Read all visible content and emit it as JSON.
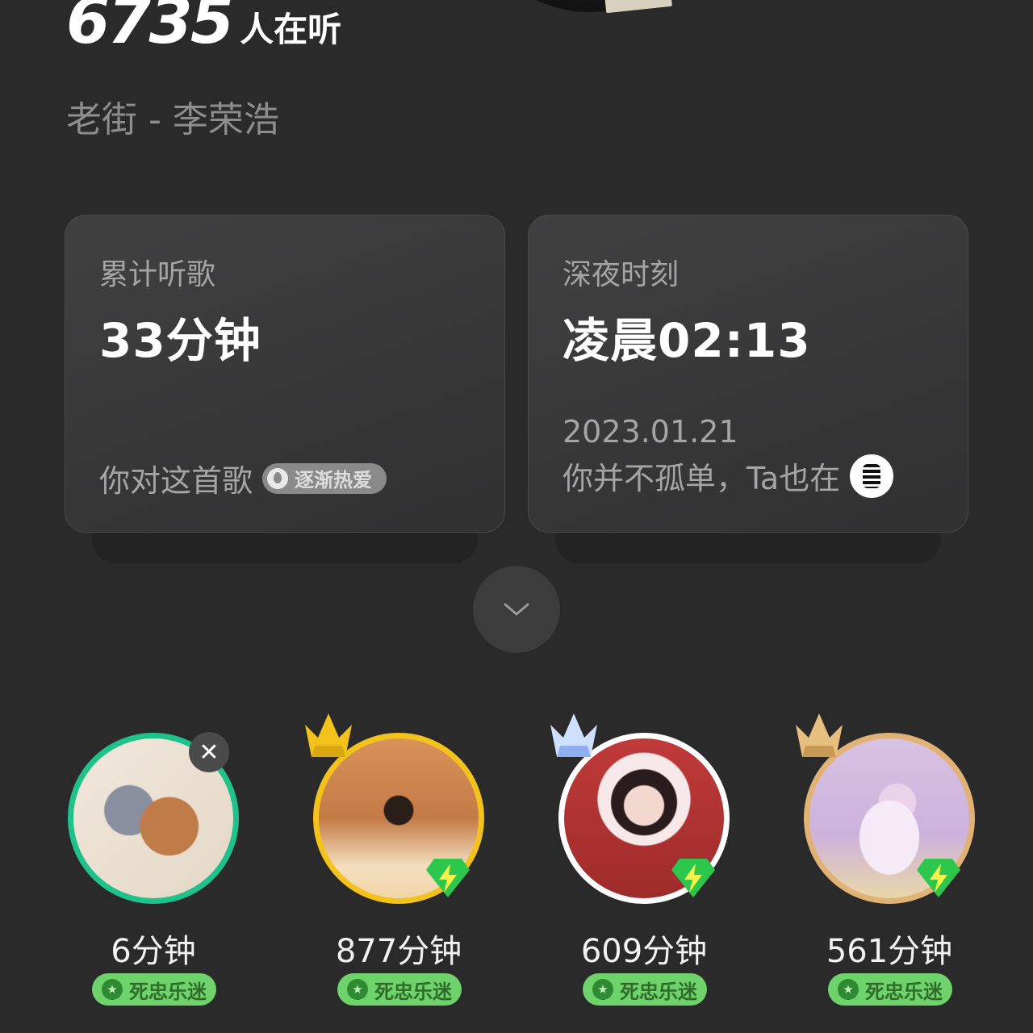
{
  "header": {
    "listener_count": "6735",
    "listener_unit": "人在听",
    "song_title": "老街 - 李荣浩"
  },
  "cards": [
    {
      "label": "累计听歌",
      "value": "33分钟",
      "footer_text": "你对这首歌",
      "tag": "逐渐热爱"
    },
    {
      "label": "深夜时刻",
      "value": "凌晨02:13",
      "date": "2023.01.21",
      "footer_text": "你并不孤单，Ta也在"
    }
  ],
  "expand_icon": "chevron-down-icon",
  "users": [
    {
      "minutes": "6分钟",
      "badge": "死忠乐迷",
      "crown": "none",
      "ring_color": "#1fc28a"
    },
    {
      "minutes": "877分钟",
      "badge": "死忠乐迷",
      "crown": "gold",
      "ring_color": "#f3c21c"
    },
    {
      "minutes": "609分钟",
      "badge": "死忠乐迷",
      "crown": "silver",
      "ring_color": "#ffffff"
    },
    {
      "minutes": "561分钟",
      "badge": "死忠乐迷",
      "crown": "bronze",
      "ring_color": "#e0b276"
    }
  ]
}
